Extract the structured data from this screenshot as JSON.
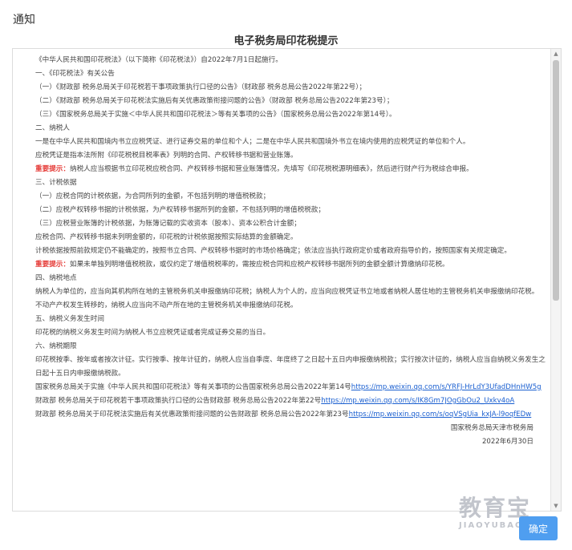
{
  "dialog": {
    "title": "通知"
  },
  "notice": {
    "heading": "电子税务局印花税提示",
    "intro": "《中华人民共和国印花税法》（以下简称《印花税法》）自2022年7月1日起施行。",
    "s1_title": "一、《印花税法》有关公告",
    "s1_items": [
      "（一）《财政部 税务总局关于印花税若干事项政策执行口径的公告》（财政部 税务总局公告2022年第22号）；",
      "（二）《财政部 税务总局关于印花税法实施后有关优惠政策衔接问题的公告》（财政部 税务总局公告2022年第23号）；",
      "（三）《国家税务总局关于实施＜中华人民共和国印花税法＞等有关事项的公告》（国家税务总局公告2022年第14号）。"
    ],
    "s2_title": "二、纳税人",
    "s2_p1": "一是在中华人民共和国境内书立应税凭证、进行证券交易的单位和个人；二是在中华人民共和国境外书立在境内使用的应税凭证的单位和个人。",
    "s2_p2": "应税凭证是指本法所附《印花税税目税率表》列明的合同、产权转移书据和营业账簿。",
    "s2_tip_label": "重要提示：",
    "s2_tip_text": "纳税人应当根据书立印花税应税合同、产权转移书据和营业账簿情况，先填写《印花税税源明细表》，然后进行财产行为税综合申报。",
    "s3_title": "三、计税依据",
    "s3_items": [
      "（一）应税合同的计税依据，为合同所列的金额，不包括列明的增值税税款；",
      "（二）应税产权转移书据的计税依据，为产权转移书据所列的金额，不包括列明的增值税税款；",
      "（三）应税营业账簿的计税依据，为账簿记载的实收资本（股本）、资本公积合计金额；"
    ],
    "s3_p1": "应税合同、产权转移书据未列明金额的，印花税的计税依据按照实际结算的金额确定。",
    "s3_p2": "计税依据按照前款规定仍不能确定的，按照书立合同、产权转移书据时的市场价格确定；依法应当执行政府定价或者政府指导价的，按照国家有关规定确定。",
    "s3_tip_label": "重要提示：",
    "s3_tip_text": "如果未单独列明增值税税款，或仅约定了增值税税率的，需按应税合同和应税产权转移书据所列的金额全额计算缴纳印花税。",
    "s4_title": "四、纳税地点",
    "s4_p1": "纳税人为单位的，应当向其机构所在地的主管税务机关申报缴纳印花税；纳税人为个人的，应当向应税凭证书立地或者纳税人居住地的主管税务机关申报缴纳印花税。",
    "s4_p2": "不动产产权发生转移的，纳税人应当向不动产所在地的主管税务机关申报缴纳印花税。",
    "s5_title": "五、纳税义务发生时间",
    "s5_p1": "印花税的纳税义务发生时间为纳税人书立应税凭证或者完成证券交易的当日。",
    "s6_title": "六、纳税期限",
    "s6_p1": "印花税按季、按年或者按次计征。实行按季、按年计征的，纳税人应当自季度、年度终了之日起十五日内申报缴纳税款；实行按次计征的，纳税人应当自纳税义务发生之日起十五日内申报缴纳税款。",
    "refs": [
      {
        "text": "国家税务总局关于实施《中华人民共和国印花税法》等有关事项的公告国家税务总局公告2022年第14号",
        "link": "https://mp.weixin.qq.com/s/YRFJ-HrLdY3UfadDHnHW5g"
      },
      {
        "text": "财政部 税务总局关于印花税若干事项政策执行口径的公告财政部 税务总局公告2022年第22号",
        "link": "https://mp.weixin.qq.com/s/IK8Gm7JOgGbOu2_Uxkv4oA"
      },
      {
        "text": "财政部 税务总局关于印花税法实施后有关优惠政策衔接问题的公告财政部 税务总局公告2022年第23号",
        "link": "https://mp.weixin.qq.com/s/oqVSgUia_kxJA-l9oqfEDw"
      }
    ],
    "signature": "国家税务总局天津市税务局",
    "date": "2022年6月30日"
  },
  "watermark": {
    "cn": "教育宝",
    "en": "JIAOYUBAO.CN"
  },
  "buttons": {
    "confirm": "确定"
  }
}
